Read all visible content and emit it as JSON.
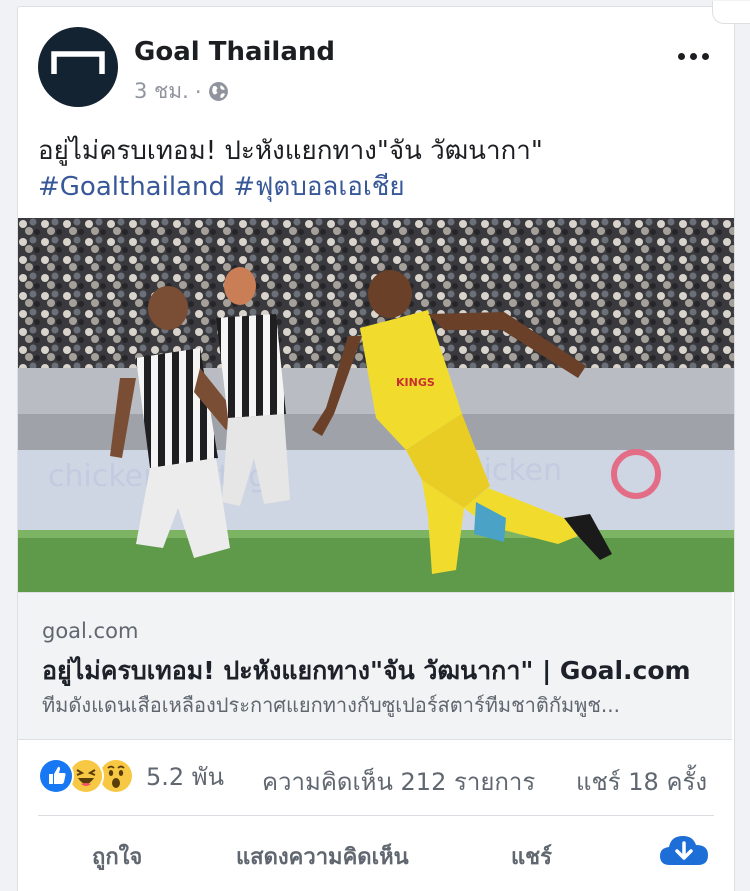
{
  "post": {
    "page_name": "Goal Thailand",
    "time": "3 ชม.",
    "separator": "·",
    "message": "อยู่ไม่ครบเทอม! ปะหังแยกทาง\"จัน วัฒนากา\"",
    "hashtags": [
      "#Goalthailand",
      "#ฟุตบอลเอเชีย"
    ]
  },
  "link_preview": {
    "domain": "goal.com",
    "title": "อยู่ไม่ครบเทอม! ปะหังแยกทาง\"จัน วัฒนากา\" | Goal.com",
    "description": "ทีมดังแดนเสือเหลืองประกาศแยกทางกับซูเปอร์สตาร์ทีมชาติกัมพูช..."
  },
  "stats": {
    "reactions_icons": [
      "like-icon",
      "haha-icon",
      "wow-icon"
    ],
    "reaction_count": "5.2 พัน",
    "comments": "ความคิดเห็น 212 รายการ",
    "shares": "แชร์ 18 ครั้ง"
  },
  "actions": {
    "like": "ถูกใจ",
    "comment": "แสดงความคิดเห็น",
    "share": "แชร์"
  },
  "colors": {
    "link": "#385898",
    "like_blue": "#1877f2",
    "emoji_yellow": "#f7c843",
    "avatar_bg": "#132331",
    "muted": "#606770"
  }
}
